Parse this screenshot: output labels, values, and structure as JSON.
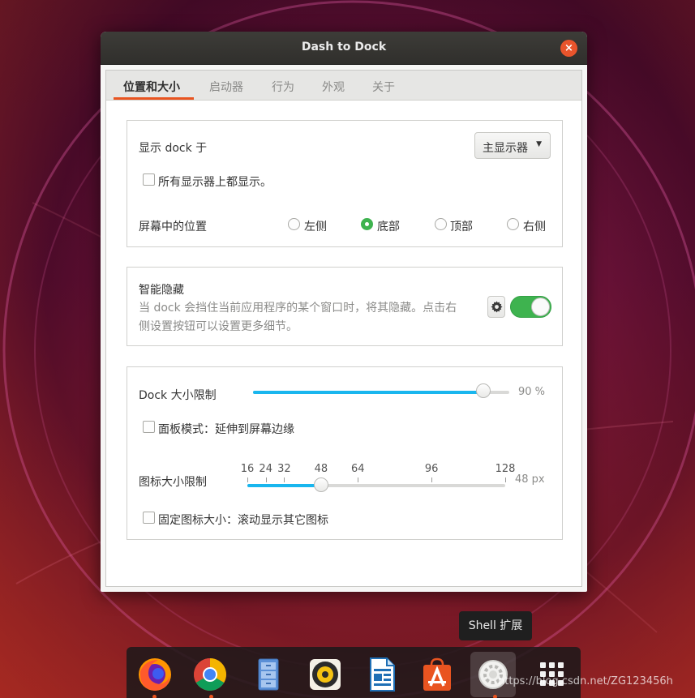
{
  "window": {
    "title": "Dash to Dock",
    "close_label": "×"
  },
  "tabs": [
    {
      "label": "位置和大小",
      "active": true
    },
    {
      "label": "启动器",
      "active": false
    },
    {
      "label": "行为",
      "active": false
    },
    {
      "label": "外观",
      "active": false
    },
    {
      "label": "关于",
      "active": false
    }
  ],
  "position_section": {
    "show_on_label": "显示 dock 于",
    "monitor_combo": {
      "selected": "主显示器",
      "arrow": "▼"
    },
    "all_monitors": {
      "label": "所有显示器上都显示。",
      "checked": false
    },
    "screen_position_label": "屏幕中的位置",
    "positions": [
      {
        "label": "左侧",
        "checked": false
      },
      {
        "label": "底部",
        "checked": true
      },
      {
        "label": "顶部",
        "checked": false
      },
      {
        "label": "右侧",
        "checked": false
      }
    ]
  },
  "intellihide_section": {
    "title": "智能隐藏",
    "description": "当 dock 会挡住当前应用程序的某个窗口时，将其隐藏。点击右侧设置按钮可以设置更多细节。",
    "enabled": true
  },
  "size_section": {
    "dock_size_label": "Dock 大小限制",
    "dock_size_value": "90 %",
    "dock_size_fraction": 0.9,
    "panel_mode": {
      "label": "面板模式：延伸到屏幕边缘",
      "checked": false
    },
    "icon_size_label": "图标大小限制",
    "icon_size_marks": [
      "16",
      "24",
      "32",
      "48",
      "64",
      "96",
      "128"
    ],
    "icon_size_value": "48 px",
    "icon_size_current": 48,
    "fixed_icon_size": {
      "label": "固定图标大小：滚动显示其它图标",
      "checked": false
    }
  },
  "tooltip": "Shell 扩展",
  "dock": {
    "items": [
      {
        "name": "firefox-icon",
        "running": true
      },
      {
        "name": "chrome-icon",
        "running": true
      },
      {
        "name": "files-icon",
        "running": false
      },
      {
        "name": "rhythmbox-icon",
        "running": false
      },
      {
        "name": "libreoffice-writer-icon",
        "running": false
      },
      {
        "name": "software-center-icon",
        "running": false
      },
      {
        "name": "shell-extension-icon",
        "running": true
      },
      {
        "name": "show-apps-icon",
        "running": false
      }
    ]
  },
  "watermark": "https://blog.csdn.net/ZG123456h",
  "colors": {
    "accent_orange": "#e95420",
    "toggle_green": "#3eb34f",
    "slider_blue": "#19b6ee"
  }
}
